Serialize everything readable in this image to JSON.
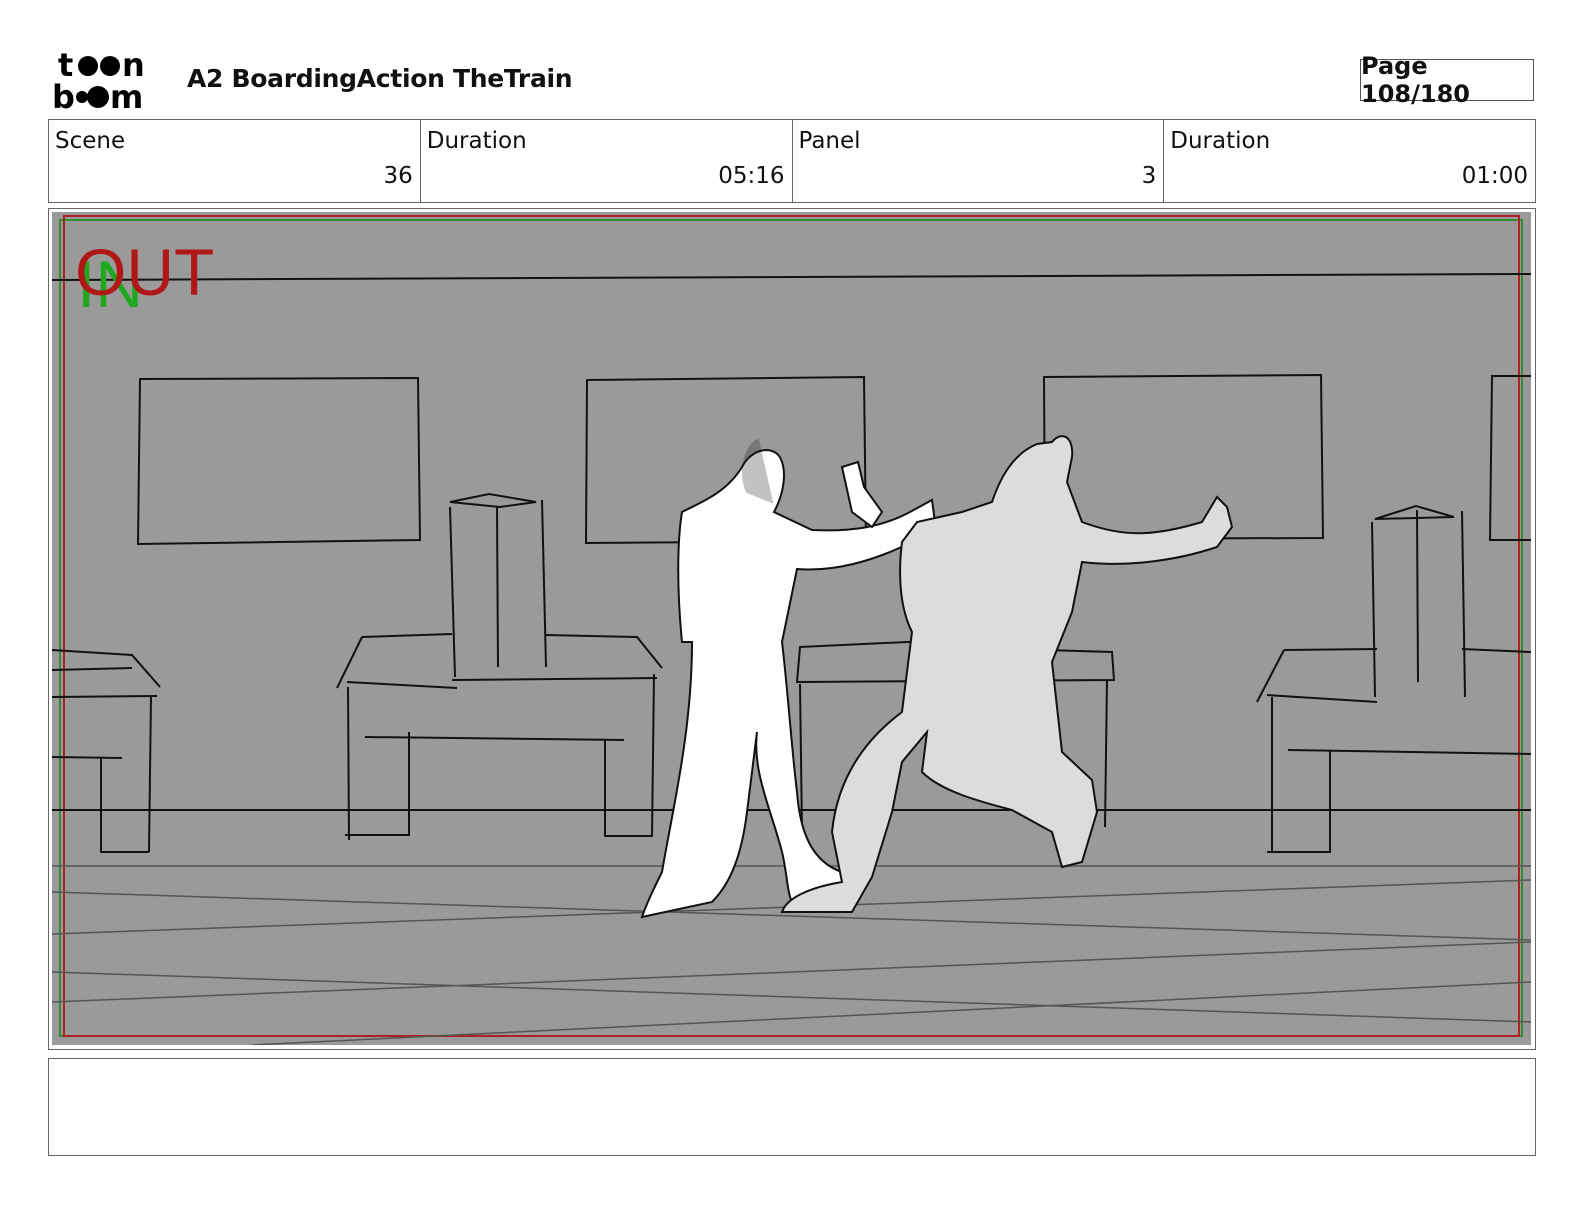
{
  "header": {
    "logo_text": "toon boom",
    "title": "A2 BoardingAction TheTrain",
    "page": "Page 108/180"
  },
  "info": [
    {
      "label": "Scene",
      "value": "36"
    },
    {
      "label": "Duration",
      "value": "05:16"
    },
    {
      "label": "Panel",
      "value": "3"
    },
    {
      "label": "Duration",
      "value": "01:00"
    }
  ],
  "panel": {
    "in_marker": "IN",
    "out_marker": "OUT",
    "colors": {
      "in": "#1fa81f",
      "out": "#b01818",
      "background": "#9a9a9a"
    }
  },
  "notes": ""
}
